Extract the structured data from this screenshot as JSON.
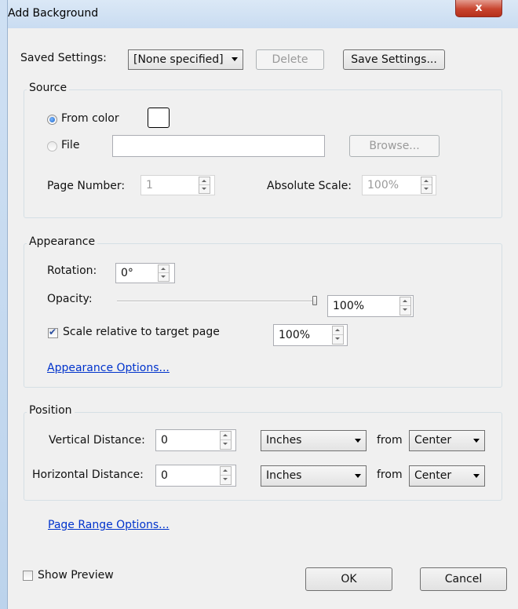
{
  "window": {
    "title": "Add Background",
    "close_label": "x"
  },
  "saved_settings": {
    "label": "Saved Settings:",
    "selected": "[None specified]",
    "delete_label": "Delete",
    "save_label": "Save Settings..."
  },
  "source": {
    "title": "Source",
    "from_color_label": "From color",
    "from_color_checked": true,
    "file_label": "File",
    "file_value": "",
    "browse_label": "Browse...",
    "page_number_label": "Page Number:",
    "page_number_value": "1",
    "absolute_scale_label": "Absolute Scale:",
    "absolute_scale_value": "100%"
  },
  "appearance": {
    "title": "Appearance",
    "rotation_label": "Rotation:",
    "rotation_value": "0°",
    "opacity_label": "Opacity:",
    "opacity_value": "100%",
    "opacity_fraction": 1.0,
    "scale_label": "Scale relative to target page",
    "scale_checked": true,
    "scale_value": "100%",
    "options_link": "Appearance Options..."
  },
  "position": {
    "title": "Position",
    "vertical_label": "Vertical Distance:",
    "vertical_value": "0",
    "vertical_unit": "Inches",
    "vertical_from_label": "from",
    "vertical_from": "Center",
    "horizontal_label": "Horizontal Distance:",
    "horizontal_value": "0",
    "horizontal_unit": "Inches",
    "horizontal_from_label": "from",
    "horizontal_from": "Center"
  },
  "page_range_link": "Page Range Options...",
  "footer": {
    "show_preview_label": "Show Preview",
    "show_preview_checked": false,
    "ok_label": "OK",
    "cancel_label": "Cancel"
  }
}
